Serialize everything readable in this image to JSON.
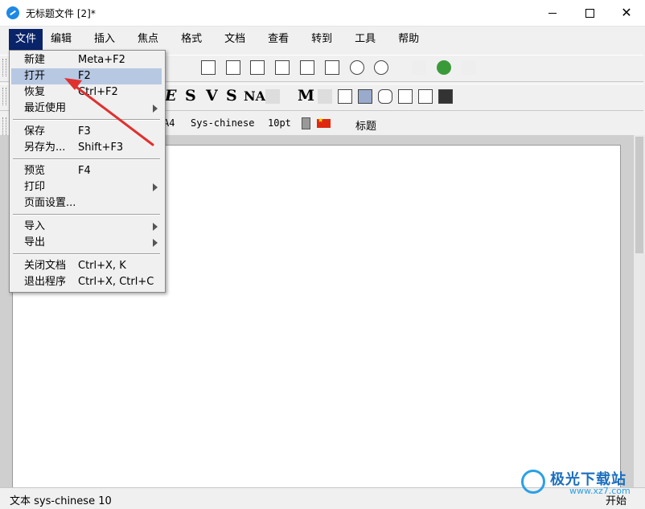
{
  "window": {
    "title": "无标题文件 [2]*",
    "close_glyph": "✕"
  },
  "menubar": {
    "items": [
      "文件",
      "编辑",
      "插入",
      "焦点",
      "格式",
      "文档",
      "查看",
      "转到",
      "工具",
      "帮助"
    ],
    "active": "文件"
  },
  "toolbar2": {
    "glyphs": [
      "E",
      "S",
      "V",
      "S",
      "NA",
      "M"
    ]
  },
  "toolbar3": {
    "paper": "A4",
    "language": "Sys-chinese",
    "font_size": "10pt",
    "style": "标题"
  },
  "file_menu": {
    "items": [
      {
        "label": "新建",
        "shortcut": "Meta+F2"
      },
      {
        "label": "打开",
        "shortcut": "F2",
        "highlighted": true
      },
      {
        "label": "恢复",
        "shortcut": "Ctrl+F2"
      },
      {
        "label": "最近使用",
        "submenu": true
      },
      {
        "label": "保存",
        "shortcut": "F3"
      },
      {
        "label": "另存为...",
        "shortcut": "Shift+F3"
      },
      {
        "label": "预览",
        "shortcut": "F4"
      },
      {
        "label": "打印",
        "submenu": true
      },
      {
        "label": "页面设置..."
      },
      {
        "label": "导入",
        "submenu": true
      },
      {
        "label": "导出",
        "submenu": true
      },
      {
        "label": "关闭文档",
        "shortcut": "Ctrl+X, K"
      },
      {
        "label": "退出程序",
        "shortcut": "Ctrl+X, Ctrl+C"
      }
    ]
  },
  "statusbar": {
    "left": "文本 sys-chinese 10",
    "right": "开始"
  },
  "watermark": {
    "name": "极光下载站",
    "url": "www.xz7.com"
  },
  "colors": {
    "menu_active_bg": "#0a246a",
    "menu_highlight": "#b7c8e3",
    "annotation_arrow": "#e03030"
  }
}
